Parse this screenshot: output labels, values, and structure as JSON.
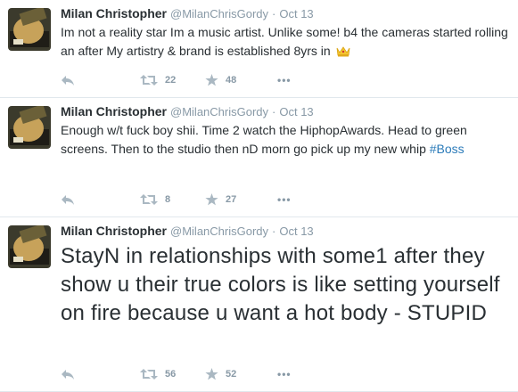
{
  "tweets": [
    {
      "fullname": "Milan Christopher",
      "username": "@MilanChrisGordy",
      "separator": "·",
      "time": "Oct 13",
      "text": "Im not a reality star Im a music artist. Unlike some! b4 the cameras started rolling an after My artistry & brand is established 8yrs in",
      "emoji": "crown",
      "retweets": "22",
      "favorites": "48"
    },
    {
      "fullname": "Milan Christopher",
      "username": "@MilanChrisGordy",
      "separator": "·",
      "time": "Oct 13",
      "text": "Enough w/t fuck boy shii. Time 2 watch the HiphopAwards. Head to green screens. Then to the studio then nD morn go pick up my new whip",
      "hashtag": "#Boss",
      "retweets": "8",
      "favorites": "27"
    },
    {
      "fullname": "Milan Christopher",
      "username": "@MilanChrisGordy",
      "separator": "·",
      "time": "Oct 13",
      "text": "StayN in relationships with some1 after they show u their true colors is like setting yourself on fire because u want a hot body - STUPID",
      "retweets": "56",
      "favorites": "52"
    }
  ],
  "more_label": "•••",
  "colors": {
    "text": "#292f33",
    "secondary": "#8899a6",
    "hashtag": "#2b7bb9",
    "divider": "#e1e8ed"
  }
}
